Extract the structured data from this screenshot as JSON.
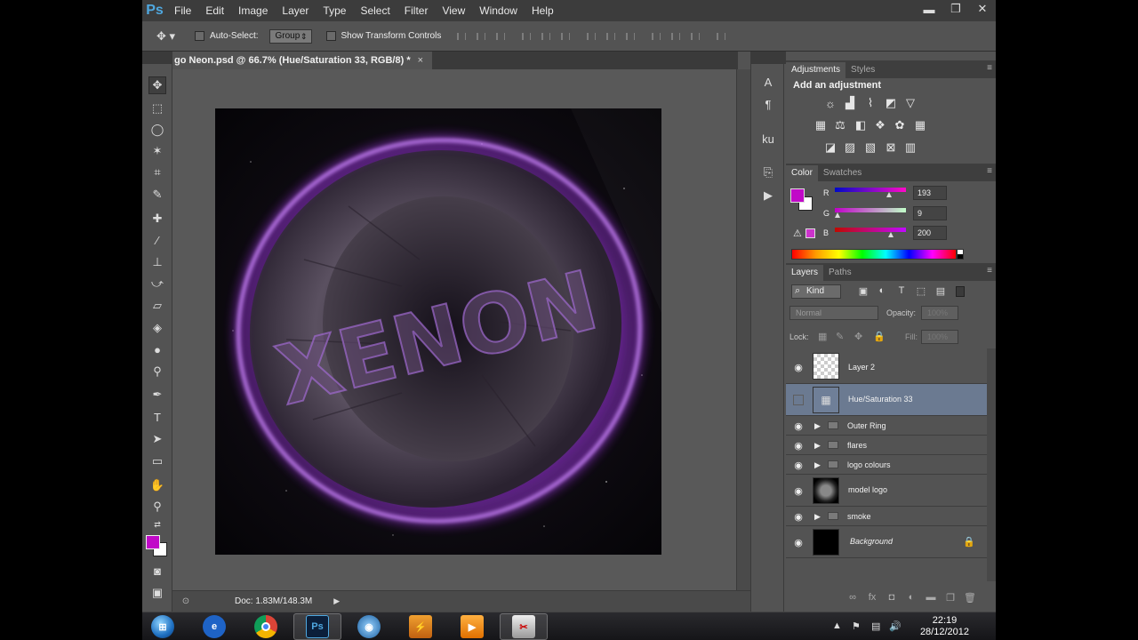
{
  "app": {
    "logo": "Ps"
  },
  "menu": [
    "File",
    "Edit",
    "Image",
    "Layer",
    "Type",
    "Select",
    "Filter",
    "View",
    "Window",
    "Help"
  ],
  "window_controls": [
    "minimize-icon",
    "restore-icon",
    "close-icon"
  ],
  "options": {
    "auto_select_label": "Auto-Select:",
    "group_value": "Group",
    "show_transform_label": "Show Transform Controls"
  },
  "document": {
    "tab_title": "go Neon.psd @ 66.7% (Hue/Saturation 33, RGB/8) *",
    "close": "×",
    "status_doc": "Doc: 1.83M/148.3M",
    "artwork_text": "XENON"
  },
  "tools": [
    "move-tool",
    "marquee-tool",
    "lasso-tool",
    "magic-wand-tool",
    "crop-tool",
    "eyedropper-tool",
    "healing-tool",
    "brush-tool",
    "stamp-tool",
    "history-brush-tool",
    "eraser-tool",
    "paint-bucket-tool",
    "blur-tool",
    "dodge-tool",
    "pen-tool",
    "type-tool",
    "path-select-tool",
    "shape-tool",
    "hand-tool",
    "zoom-tool",
    "quick-mask-tool",
    "screen-mode-tool"
  ],
  "adjustments_panel": {
    "tabs": [
      "Adjustments",
      "Styles"
    ],
    "title": "Add an adjustment"
  },
  "color_panel": {
    "tabs": [
      "Color",
      "Swatches"
    ],
    "channels": [
      {
        "label": "R",
        "value": "193",
        "fraction": 0.757
      },
      {
        "label": "G",
        "value": "9",
        "fraction": 0.035
      },
      {
        "label": "B",
        "value": "200",
        "fraction": 0.784
      }
    ],
    "foreground": "#c109c8",
    "background": "#ffffff"
  },
  "layers_panel": {
    "tabs": [
      "Layers",
      "Paths"
    ],
    "filter_label": "Kind",
    "blend_mode": "Normal",
    "opacity_label": "Opacity:",
    "opacity_value": "100%",
    "lock_label": "Lock:",
    "fill_label": "Fill:",
    "fill_value": "100%",
    "layers": [
      {
        "name": "Layer 2",
        "visible": true,
        "kind": "pixel"
      },
      {
        "name": "Hue/Saturation 33",
        "visible": false,
        "kind": "adjustment",
        "selected": true
      },
      {
        "name": "Outer Ring",
        "visible": true,
        "kind": "group"
      },
      {
        "name": "flares",
        "visible": true,
        "kind": "group"
      },
      {
        "name": "logo colours",
        "visible": true,
        "kind": "group"
      },
      {
        "name": "model logo",
        "visible": true,
        "kind": "smart"
      },
      {
        "name": "smoke",
        "visible": true,
        "kind": "group"
      },
      {
        "name": "Background",
        "visible": true,
        "kind": "background",
        "locked": true
      }
    ]
  },
  "taskbar": {
    "items": [
      "start-orb",
      "ie-icon",
      "chrome-icon",
      "photoshop-icon",
      "media-icon",
      "app-icon",
      "vlc-icon",
      "tool-icon"
    ],
    "ps_label": "Ps",
    "time": "22:19",
    "date": "28/12/2012"
  },
  "colors": {
    "neon": "#b23cff",
    "selection": "#6b7a91",
    "panel": "#535353"
  }
}
